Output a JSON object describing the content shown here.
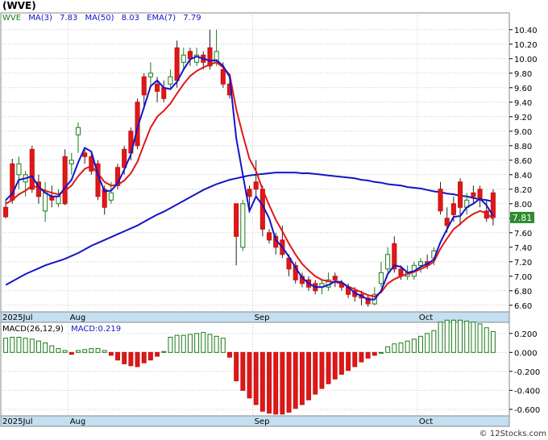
{
  "chart_data": {
    "type": "candlestick",
    "title": "(WVE)",
    "legend": {
      "ticker": "WVE",
      "ma3": "MA(3)",
      "ma3_val": "7.83",
      "ma50": "MA(50)",
      "ma50_val": "8.03",
      "ema7": "EMA(7)",
      "ema7_val": "7.79"
    },
    "price_axis": {
      "ylim": [
        6.52,
        10.62
      ],
      "ticks": [
        "6.60",
        "6.80",
        "7.00",
        "7.20",
        "7.40",
        "7.60",
        "7.80",
        "8.00",
        "8.20",
        "8.40",
        "8.60",
        "8.80",
        "9.00",
        "9.20",
        "9.40",
        "9.60",
        "9.80",
        "10.00",
        "10.20",
        "10.40"
      ],
      "last_price": "7.81"
    },
    "months": [
      {
        "label": "2025Jul",
        "index": 0
      },
      {
        "label": "Aug",
        "index": 10
      },
      {
        "label": "Sep",
        "index": 38
      },
      {
        "label": "Oct",
        "index": 63
      }
    ],
    "candles": [
      [
        7.95,
        7.82,
        8.05,
        7.8
      ],
      [
        8.55,
        8.05,
        8.62,
        8.0
      ],
      [
        8.4,
        8.55,
        8.65,
        8.2
      ],
      [
        8.3,
        8.4,
        8.45,
        8.1
      ],
      [
        8.75,
        8.2,
        8.8,
        8.15
      ],
      [
        8.3,
        8.1,
        8.4,
        8.0
      ],
      [
        7.9,
        8.15,
        8.3,
        7.75
      ],
      [
        8.1,
        8.05,
        8.25,
        7.95
      ],
      [
        8.0,
        8.1,
        8.2,
        7.95
      ],
      [
        8.65,
        8.0,
        8.75,
        7.98
      ],
      [
        8.55,
        8.6,
        8.7,
        8.4
      ],
      [
        8.95,
        9.05,
        9.12,
        8.7
      ],
      [
        8.7,
        8.65,
        8.75,
        8.55
      ],
      [
        8.65,
        8.45,
        8.7,
        8.4
      ],
      [
        8.55,
        8.1,
        8.6,
        8.05
      ],
      [
        8.2,
        7.95,
        8.25,
        7.85
      ],
      [
        8.05,
        8.15,
        8.3,
        8.0
      ],
      [
        8.5,
        8.25,
        8.55,
        8.2
      ],
      [
        8.75,
        8.5,
        8.8,
        8.4
      ],
      [
        9.0,
        8.7,
        9.05,
        8.6
      ],
      [
        9.4,
        8.8,
        9.45,
        8.75
      ],
      [
        9.75,
        9.5,
        9.8,
        9.3
      ],
      [
        9.75,
        9.8,
        9.95,
        9.6
      ],
      [
        9.65,
        9.55,
        9.75,
        9.4
      ],
      [
        9.6,
        9.45,
        9.7,
        9.4
      ],
      [
        9.65,
        9.75,
        9.85,
        9.6
      ],
      [
        10.15,
        9.7,
        10.25,
        9.6
      ],
      [
        9.95,
        10.05,
        10.15,
        9.85
      ],
      [
        10.1,
        10.0,
        10.15,
        9.9
      ],
      [
        9.95,
        10.05,
        10.15,
        9.9
      ],
      [
        10.05,
        9.95,
        10.1,
        9.85
      ],
      [
        10.15,
        9.9,
        10.4,
        9.85
      ],
      [
        9.95,
        10.1,
        10.4,
        9.9
      ],
      [
        9.85,
        9.65,
        9.95,
        9.6
      ],
      [
        9.65,
        9.5,
        9.75,
        9.45
      ],
      [
        8.0,
        7.55,
        8.0,
        7.15
      ],
      [
        7.4,
        8.0,
        8.05,
        7.35
      ],
      [
        8.2,
        8.1,
        8.25,
        7.9
      ],
      [
        8.3,
        8.2,
        8.6,
        8.1
      ],
      [
        8.2,
        7.65,
        8.25,
        7.55
      ],
      [
        7.6,
        7.5,
        7.65,
        7.45
      ],
      [
        7.55,
        7.4,
        7.6,
        7.3
      ],
      [
        7.5,
        7.3,
        7.7,
        7.25
      ],
      [
        7.25,
        7.1,
        7.3,
        7.0
      ],
      [
        7.15,
        6.95,
        7.2,
        6.9
      ],
      [
        7.0,
        6.9,
        7.05,
        6.85
      ],
      [
        6.95,
        6.85,
        7.0,
        6.8
      ],
      [
        6.9,
        6.8,
        6.95,
        6.75
      ],
      [
        6.85,
        6.9,
        6.95,
        6.75
      ],
      [
        6.85,
        6.95,
        7.05,
        6.8
      ],
      [
        7.0,
        6.95,
        7.05,
        6.85
      ],
      [
        6.9,
        6.85,
        6.95,
        6.8
      ],
      [
        6.85,
        6.75,
        6.9,
        6.7
      ],
      [
        6.8,
        6.72,
        6.85,
        6.65
      ],
      [
        6.75,
        6.7,
        6.8,
        6.6
      ],
      [
        6.7,
        6.62,
        6.75,
        6.58
      ],
      [
        6.62,
        6.75,
        6.85,
        6.6
      ],
      [
        6.9,
        7.05,
        7.2,
        6.85
      ],
      [
        7.1,
        7.3,
        7.4,
        7.05
      ],
      [
        7.45,
        7.1,
        7.55,
        7.05
      ],
      [
        7.1,
        7.0,
        7.15,
        6.95
      ],
      [
        7.0,
        7.05,
        7.15,
        6.95
      ],
      [
        7.0,
        7.15,
        7.2,
        6.95
      ],
      [
        7.15,
        7.2,
        7.25,
        7.05
      ],
      [
        7.2,
        7.15,
        7.3,
        7.1
      ],
      [
        7.25,
        7.35,
        7.4,
        7.15
      ],
      [
        8.2,
        7.9,
        8.3,
        7.85
      ],
      [
        7.8,
        7.7,
        7.95,
        7.6
      ],
      [
        8.0,
        7.85,
        8.1,
        7.75
      ],
      [
        8.3,
        7.95,
        8.35,
        7.7
      ],
      [
        7.95,
        8.05,
        8.15,
        7.85
      ],
      [
        8.15,
        8.1,
        8.25,
        8.0
      ],
      [
        8.2,
        8.05,
        8.25,
        7.95
      ],
      [
        7.9,
        7.8,
        8.05,
        7.75
      ],
      [
        8.15,
        7.81,
        8.2,
        7.7
      ]
    ],
    "ma3": [
      8.05,
      8.14,
      8.33,
      8.35,
      8.38,
      8.23,
      8.15,
      8.1,
      8.1,
      8.22,
      8.33,
      8.57,
      8.77,
      8.72,
      8.4,
      8.17,
      8.18,
      8.28,
      8.47,
      8.68,
      9.05,
      9.33,
      9.62,
      9.7,
      9.6,
      9.58,
      9.68,
      9.85,
      9.99,
      10.03,
      10.0,
      9.97,
      9.98,
      9.9,
      9.75,
      8.9,
      8.4,
      7.9,
      8.1,
      7.98,
      7.8,
      7.5,
      7.4,
      7.27,
      7.12,
      6.98,
      6.9,
      6.85,
      6.85,
      6.88,
      6.93,
      6.92,
      6.85,
      6.77,
      6.73,
      6.68,
      6.68,
      6.8,
      7.03,
      7.15,
      7.13,
      7.05,
      7.07,
      7.13,
      7.17,
      7.23,
      7.47,
      7.65,
      7.82,
      7.83,
      7.95,
      8.0,
      8.07,
      7.98,
      7.83
    ],
    "ma50": [
      6.88,
      6.93,
      6.98,
      7.03,
      7.07,
      7.11,
      7.15,
      7.18,
      7.21,
      7.24,
      7.28,
      7.32,
      7.37,
      7.42,
      7.46,
      7.5,
      7.54,
      7.58,
      7.62,
      7.66,
      7.7,
      7.75,
      7.8,
      7.85,
      7.89,
      7.94,
      7.99,
      8.04,
      8.09,
      8.14,
      8.19,
      8.23,
      8.27,
      8.3,
      8.33,
      8.35,
      8.37,
      8.39,
      8.4,
      8.41,
      8.42,
      8.43,
      8.43,
      8.43,
      8.43,
      8.42,
      8.42,
      8.41,
      8.4,
      8.39,
      8.38,
      8.37,
      8.36,
      8.35,
      8.33,
      8.32,
      8.3,
      8.29,
      8.27,
      8.26,
      8.25,
      8.23,
      8.22,
      8.21,
      8.19,
      8.17,
      8.16,
      8.14,
      8.13,
      8.11,
      8.1,
      8.08,
      8.06,
      8.05,
      8.03
    ],
    "ema7": [
      8.0,
      8.05,
      8.13,
      8.18,
      8.25,
      8.22,
      8.18,
      8.15,
      8.13,
      8.18,
      8.25,
      8.38,
      8.48,
      8.52,
      8.42,
      8.3,
      8.25,
      8.26,
      8.32,
      8.42,
      8.58,
      8.82,
      9.05,
      9.2,
      9.28,
      9.38,
      9.52,
      9.65,
      9.76,
      9.83,
      9.88,
      9.92,
      9.95,
      9.88,
      9.78,
      9.3,
      8.95,
      8.62,
      8.45,
      8.2,
      7.98,
      7.78,
      7.62,
      7.45,
      7.3,
      7.17,
      7.08,
      7.0,
      6.95,
      6.93,
      6.92,
      6.9,
      6.86,
      6.82,
      6.78,
      6.74,
      6.72,
      6.78,
      6.9,
      6.96,
      7.0,
      7.03,
      7.06,
      7.1,
      7.14,
      7.2,
      7.38,
      7.52,
      7.65,
      7.72,
      7.8,
      7.86,
      7.9,
      7.87,
      7.79
    ],
    "macd": {
      "label": "MACD(26,12,9)",
      "value_label": "MACD:0.219",
      "ylim": [
        -0.66,
        0.3
      ],
      "ticks": [
        "0.200",
        "0.000",
        "-0.200",
        "-0.400",
        "-0.600"
      ],
      "values": [
        0.15,
        0.16,
        0.16,
        0.15,
        0.14,
        0.12,
        0.1,
        0.07,
        0.04,
        0.02,
        -0.02,
        0.02,
        0.03,
        0.04,
        0.04,
        0.02,
        -0.03,
        -0.08,
        -0.12,
        -0.14,
        -0.15,
        -0.11,
        -0.08,
        -0.04,
        0.01,
        0.16,
        0.18,
        0.18,
        0.19,
        0.2,
        0.21,
        0.19,
        0.17,
        0.15,
        -0.05,
        -0.3,
        -0.4,
        -0.48,
        -0.55,
        -0.62,
        -0.64,
        -0.65,
        -0.65,
        -0.63,
        -0.59,
        -0.55,
        -0.5,
        -0.44,
        -0.38,
        -0.33,
        -0.28,
        -0.23,
        -0.19,
        -0.15,
        -0.1,
        -0.06,
        -0.03,
        0.0,
        0.06,
        0.09,
        0.1,
        0.12,
        0.14,
        0.17,
        0.2,
        0.23,
        0.32,
        0.34,
        0.34,
        0.34,
        0.33,
        0.32,
        0.3,
        0.26,
        0.22
      ]
    }
  }
}
